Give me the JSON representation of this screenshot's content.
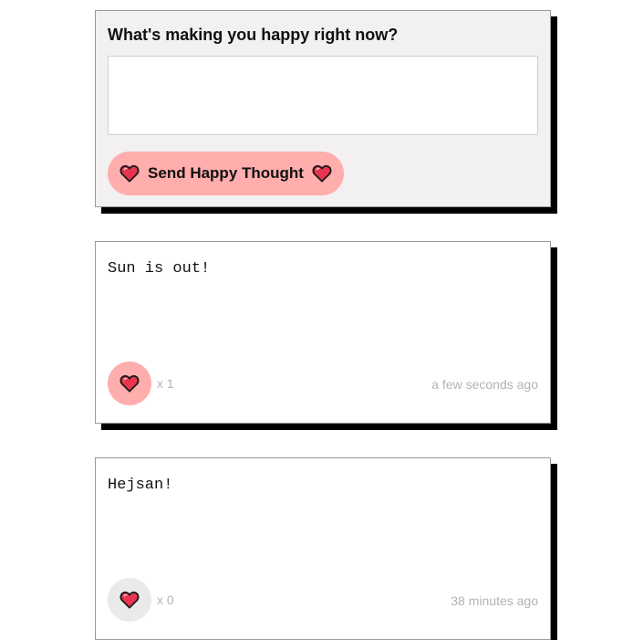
{
  "form": {
    "title": "What's making you happy right now?",
    "input_value": "",
    "input_placeholder": "",
    "send_label": "Send Happy Thought"
  },
  "thoughts": [
    {
      "message": "Sun is out!",
      "likes_label": "x 1",
      "time_label": "a few seconds ago",
      "liked": true
    },
    {
      "message": "Hejsan!",
      "likes_label": "x 0",
      "time_label": "38 minutes ago",
      "liked": false
    }
  ],
  "colors": {
    "accent_pink": "#ffadad",
    "unliked_gray": "#eaeaea",
    "heart_red": "#e8354f",
    "form_bg": "#f2f0f0",
    "muted_text": "#b3b3b3"
  },
  "icons": {
    "heart": "heart-icon"
  }
}
